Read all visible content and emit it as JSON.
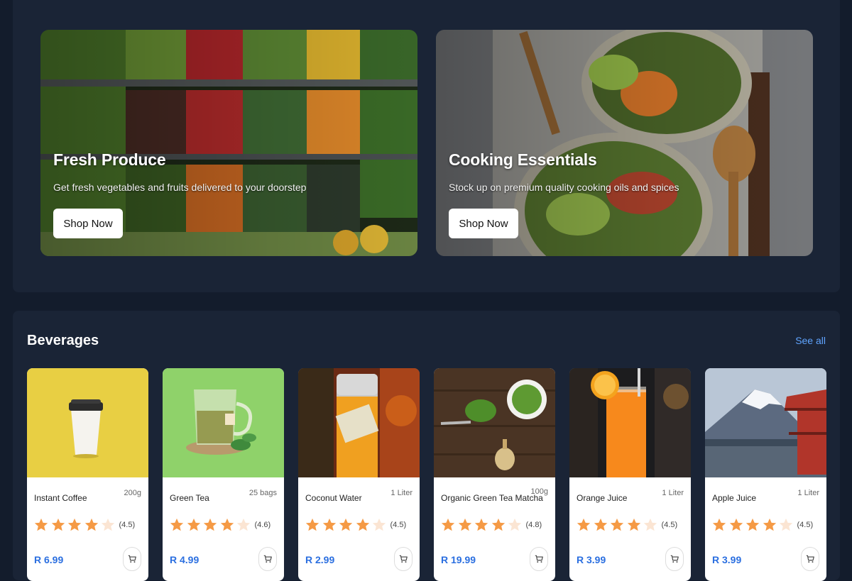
{
  "promos": [
    {
      "title": "Fresh Produce",
      "subtitle": "Get fresh vegetables and fruits delivered to your doorstep",
      "button": "Shop Now"
    },
    {
      "title": "Cooking Essentials",
      "subtitle": "Stock up on premium quality cooking oils and spices",
      "button": "Shop Now"
    }
  ],
  "beverages": {
    "title": "Beverages",
    "see_all": "See all",
    "products": [
      {
        "name": "Instant Coffee",
        "size": "200g",
        "rating": "(4.5)",
        "price": "R 6.99"
      },
      {
        "name": "Green Tea",
        "size": "25 bags",
        "rating": "(4.6)",
        "price": "R 4.99"
      },
      {
        "name": "Coconut Water",
        "size": "1 Liter",
        "rating": "(4.5)",
        "price": "R 2.99"
      },
      {
        "name": "Organic Green Tea Matcha",
        "size": "100g",
        "rating": "(4.8)",
        "price": "R 19.99"
      },
      {
        "name": "Orange Juice",
        "size": "1 Liter",
        "rating": "(4.5)",
        "price": "R 3.99"
      },
      {
        "name": "Apple Juice",
        "size": "1 Liter",
        "rating": "(4.5)",
        "price": "R 3.99"
      }
    ]
  },
  "icons": {
    "cart": "cart-icon",
    "star": "star-icon"
  },
  "colors": {
    "page_bg": "#131c2c",
    "panel_bg": "#1a2436",
    "accent_link": "#5fa4ff",
    "price": "#2b6fe0",
    "star": "#f59a45"
  }
}
